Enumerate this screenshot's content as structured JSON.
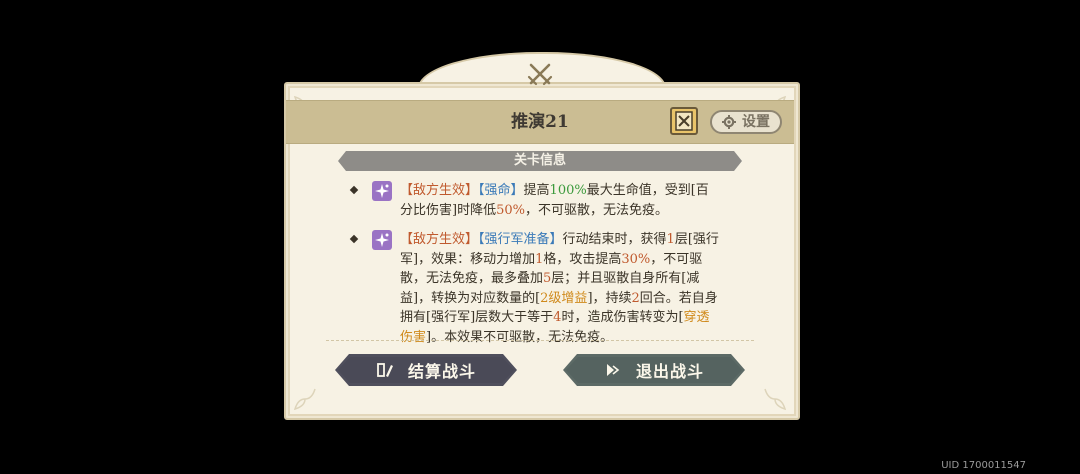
{
  "dialog": {
    "title": "推演21",
    "settings_label": "设置",
    "section_title": "关卡信息"
  },
  "entries": [
    {
      "tag": "【敌方生效】",
      "name": "【强命】",
      "text_a": "提高",
      "hl1": "100%",
      "text_b": "最大生命值，受到[百分比伤害]时降低",
      "hl2": "50%",
      "text_c": "，不可驱散，无法免疫。"
    },
    {
      "tag": "【敌方生效】",
      "name": "【强行军准备】",
      "t1": "行动结束时，获得",
      "h1": "1",
      "t2": "层[强行军]，效果：移动力增加",
      "h2": "1",
      "t3": "格，攻击提高",
      "h3": "30%",
      "t4": "，不可驱散，无法免疫，最多叠加",
      "h4": "5",
      "t5": "层；并且驱散自身所有[减益]，转换为对应数量的[",
      "h5": "2级增益",
      "t6": "]，持续",
      "h6": "2",
      "t7": "回合。若自身拥有[强行军]层数大于等于",
      "h7": "4",
      "t8": "时，造成伤害转变为[",
      "h8": "穿透伤害",
      "t9": "]。本效果不可驱散，无法免疫。"
    }
  ],
  "buttons": {
    "settle": "结算战斗",
    "exit": "退出战斗"
  },
  "uid": "UID 1700011547",
  "colors": {
    "tag_red": "#c05a2e",
    "name_blue": "#3a7ab8",
    "value_green": "#3c9a3c",
    "value_orange": "#d08a1c"
  },
  "icons": [
    "crossed-swords-icon",
    "book-icon",
    "gear-icon",
    "buff-sparkle-icon",
    "notes-icon",
    "play-arrows-icon"
  ]
}
